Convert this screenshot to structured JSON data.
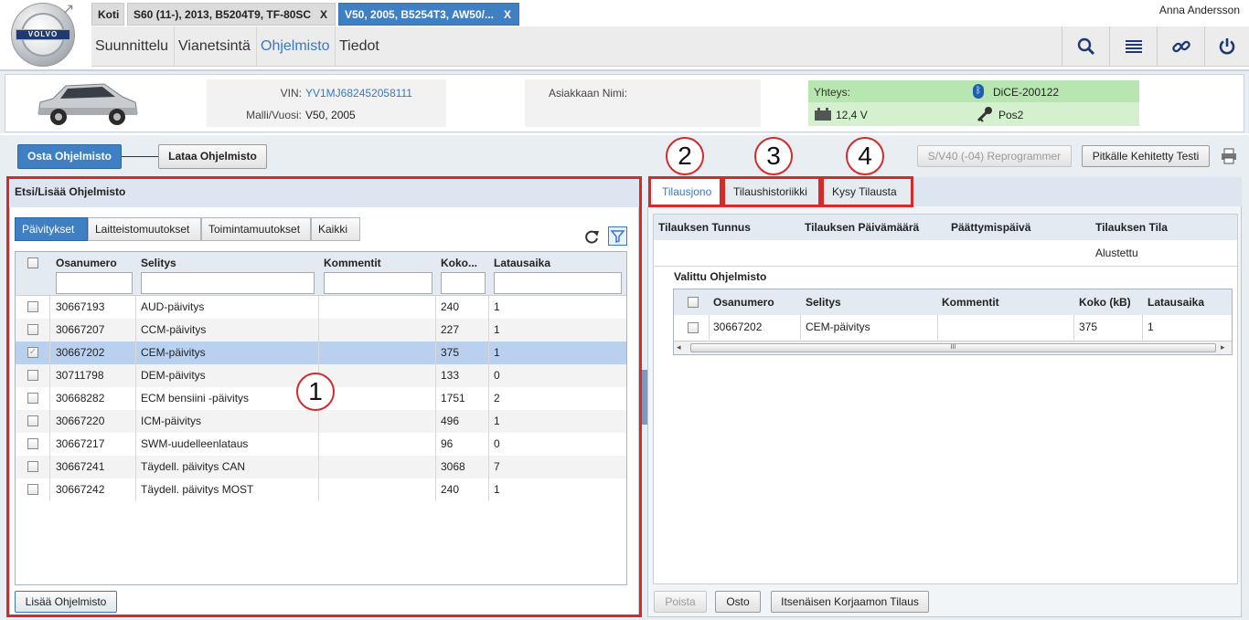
{
  "header": {
    "logo_text": "VOLVO",
    "user": "Anna Andersson",
    "tabs": [
      {
        "label": "Koti",
        "closable": false,
        "active": false
      },
      {
        "label": "S60 (11-), 2013, B5204T9, TF-80SC",
        "closable": true,
        "active": false
      },
      {
        "label": "V50, 2005, B5254T3, AW50/...",
        "closable": true,
        "active": true
      }
    ],
    "close_glyph": "X",
    "nav": [
      "Suunnittelu",
      "Vianetsintä",
      "Ohjelmisto",
      "Tiedot"
    ],
    "nav_active": "Ohjelmisto",
    "icons": [
      "search-icon",
      "list-icon",
      "link-icon",
      "power-icon"
    ]
  },
  "vehicle": {
    "vin_label": "VIN:",
    "vin": "YV1MJ682452058111",
    "model_label": "Malli/Vuosi:",
    "model": "V50, 2005",
    "customer_label": "Asiakkaan Nimi:",
    "customer": "",
    "connection_label": "Yhteys:",
    "device": "DiCE-200122",
    "voltage": "12,4 V",
    "ignition": "Pos2",
    "accent_colors": {
      "connection_bg": "#b8e6b0",
      "connection_bg2": "#d4f0ce"
    }
  },
  "toolbar": {
    "buy_label": "Osta Ohjelmisto",
    "download_label": "Lataa Ohjelmisto",
    "reprogrammer_label": "S/V40 (-04) Reprogrammer",
    "extended_test_label": "Pitkälle Kehitetty Testi"
  },
  "left": {
    "title": "Etsi/Lisää Ohjelmisto",
    "subtabs": [
      "Päivitykset",
      "Laitteistomuutokset",
      "Toimintamuutokset",
      "Kaikki"
    ],
    "columns": [
      "Osanumero",
      "Selitys",
      "Kommentit",
      "Koko...",
      "Latausaika"
    ],
    "rows": [
      {
        "part": "30667193",
        "desc": "AUD-päivitys",
        "comment": "",
        "size": "240",
        "time": "1",
        "checked": false
      },
      {
        "part": "30667207",
        "desc": "CCM-päivitys",
        "comment": "",
        "size": "227",
        "time": "1",
        "checked": false
      },
      {
        "part": "30667202",
        "desc": "CEM-päivitys",
        "comment": "",
        "size": "375",
        "time": "1",
        "checked": true
      },
      {
        "part": "30711798",
        "desc": "DEM-päivitys",
        "comment": "",
        "size": "133",
        "time": "0",
        "checked": false
      },
      {
        "part": "30668282",
        "desc": "ECM bensiini -päivitys",
        "comment": "",
        "size": "1751",
        "time": "2",
        "checked": false
      },
      {
        "part": "30667220",
        "desc": "ICM-päivitys",
        "comment": "",
        "size": "496",
        "time": "1",
        "checked": false
      },
      {
        "part": "30667217",
        "desc": "SWM-uudelleenlataus",
        "comment": "",
        "size": "96",
        "time": "0",
        "checked": false
      },
      {
        "part": "30667241",
        "desc": "Täydell. päivitys CAN",
        "comment": "",
        "size": "3068",
        "time": "7",
        "checked": false
      },
      {
        "part": "30667242",
        "desc": "Täydell. päivitys MOST",
        "comment": "",
        "size": "240",
        "time": "1",
        "checked": false
      }
    ],
    "add_button": "Lisää Ohjelmisto"
  },
  "right": {
    "tabs": [
      "Tilausjono",
      "Tilaushistoriikki",
      "Kysy Tilausta"
    ],
    "columns": [
      "Tilauksen Tunnus",
      "Tilauksen Päivämäärä",
      "Päättymispäivä",
      "Tilauksen Tila"
    ],
    "status": "Alustettu",
    "selected_title": "Valittu Ohjelmisto",
    "sub_columns": [
      "Osanumero",
      "Selitys",
      "Kommentit",
      "Koko (kB)",
      "Latausaika"
    ],
    "sub_rows": [
      {
        "part": "30667202",
        "desc": "CEM-päivitys",
        "comment": "",
        "size": "375",
        "time": "1"
      }
    ],
    "scroll_thumb": "III",
    "buttons": [
      "Poista",
      "Osto",
      "Itsenäisen Korjaamon Tilaus"
    ]
  },
  "annotations": [
    "1",
    "2",
    "3",
    "4"
  ]
}
